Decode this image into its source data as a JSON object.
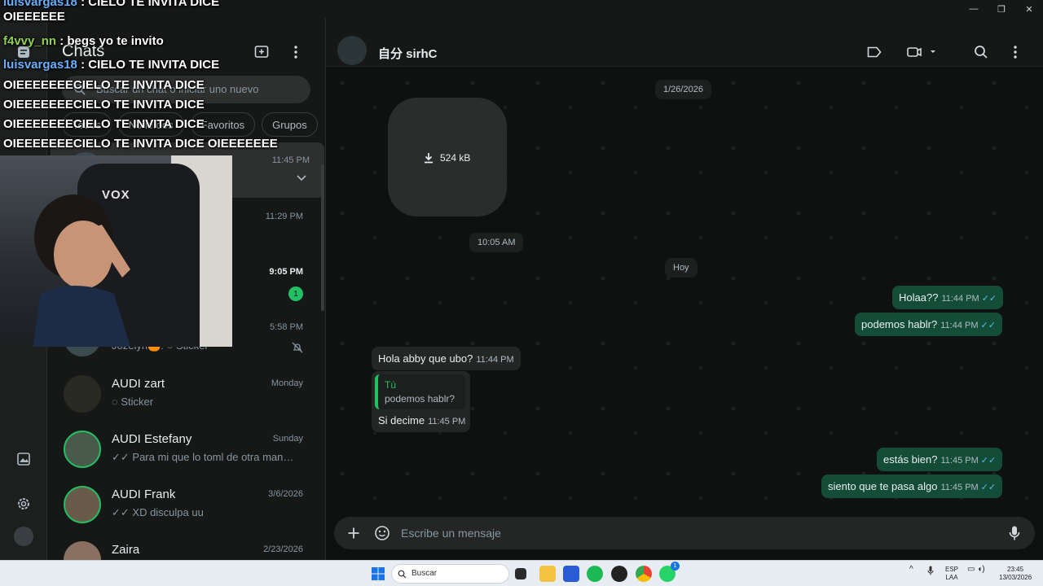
{
  "window": {
    "minimize": "—",
    "restore": "❐",
    "close": "✕"
  },
  "sidebar_list": {
    "title": "Chats",
    "search_placeholder": "Buscar un chat o iniciar uno nuevo",
    "filters": [
      "Todos",
      "No leídos",
      "Favoritos",
      "Grupos"
    ],
    "chats": [
      {
        "name": "",
        "snippet": "",
        "time": "11:45 PM",
        "selected": true
      },
      {
        "name": "",
        "snippet": "",
        "time": "11:29 PM"
      },
      {
        "name": "",
        "snippet": "",
        "time": "9:05 PM",
        "unread": "1"
      },
      {
        "name": "",
        "snippet": "Jozelyn🍊: ○ Sticker",
        "time": "5:58 PM",
        "muted": true
      },
      {
        "name": "AUDI zart",
        "snippet": "◌ Sticker",
        "time": "Monday"
      },
      {
        "name": "AUDI Estefany",
        "snippet": "✓✓ Para mi que lo toml de otra manera ...",
        "time": "Sunday"
      },
      {
        "name": "AUDI Frank",
        "snippet": "✓✓ XD disculpa uu",
        "time": "3/6/2026"
      },
      {
        "name": "Zaira",
        "snippet": "",
        "time": "2/23/2026"
      }
    ]
  },
  "chat": {
    "contact_name": "自分 sirhC",
    "date_pill_1": "1/26/2026",
    "media_size": "524 kB",
    "time_pill": "10:05 AM",
    "date_pill_2": "Hoy",
    "messages": [
      {
        "dir": "out",
        "text": "Holaa??",
        "time": "11:44 PM",
        "ticks": "✓✓"
      },
      {
        "dir": "out",
        "text": "podemos hablr?",
        "time": "11:44 PM",
        "ticks": "✓✓"
      },
      {
        "dir": "in",
        "text": "Hola abby que ubo?",
        "time": "11:44 PM"
      },
      {
        "dir": "in",
        "quote_author": "Tú",
        "quote_text": "podemos hablr?",
        "text": "Si decime",
        "time": "11:45 PM"
      },
      {
        "dir": "out",
        "text": "estás bien?",
        "time": "11:45 PM",
        "ticks": "✓✓"
      },
      {
        "dir": "out",
        "text": "siento que te pasa algo",
        "time": "11:45 PM",
        "ticks": "✓✓"
      }
    ],
    "composer_placeholder": "Escribe un mensaje"
  },
  "stream_overlay": {
    "lines": [
      {
        "user": "luisvargas18",
        "text": ": CIELO TE INVITA DICE"
      },
      {
        "user": "",
        "text": "OIEEEEEE"
      },
      {
        "user": "f4vvy_nn",
        "text": ": begs yo te invito"
      },
      {
        "user": "luisvargas18",
        "text": ": CIELO TE INVITA DICE"
      },
      {
        "user": "",
        "text": "OIEEEEEEECIELO TE INVITA DICE"
      },
      {
        "user": "",
        "text": "OIEEEEEEECIELO TE INVITA DICE"
      },
      {
        "user": "",
        "text": "OIEEEEEEECIELO TE INVITA DICE"
      },
      {
        "user": "",
        "text": "OIEEEEEEECIELO TE INVITA DICE OIEEEEEEE"
      }
    ],
    "webcam_logo": "VOX"
  },
  "taskbar": {
    "search_label": "Buscar",
    "lang": "ESP",
    "lang2": "LAA",
    "clock_time": "23:45",
    "clock_date": "13/03/2026",
    "whatsapp_badge": "1"
  },
  "colors": {
    "accent": "#21c063",
    "outgoing": "#144d37",
    "incoming": "#242626",
    "ticks": "#53bdeb"
  }
}
